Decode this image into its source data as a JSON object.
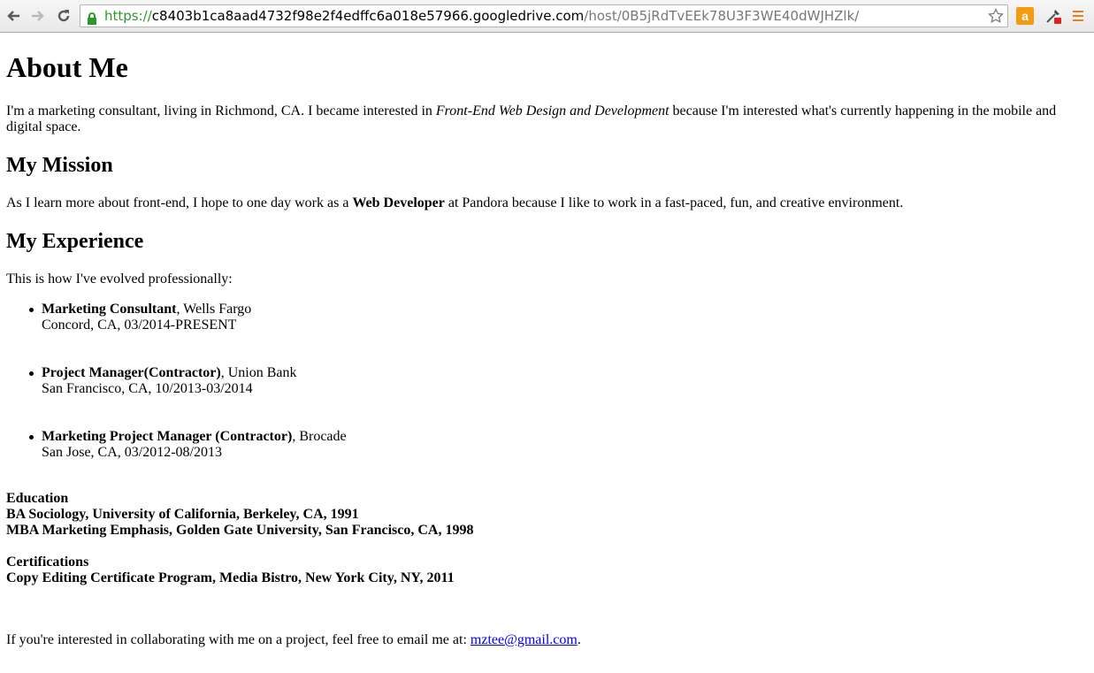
{
  "browser": {
    "url_scheme": "https://",
    "url_host": "c8403b1ca8aad4732f98e2f4edffc6a018e57966.googledrive.com",
    "url_path": "/host/0B5jRdTvEEk78U3F3WE40dWJHZlk/"
  },
  "page": {
    "title": "About Me",
    "intro": {
      "before": "I'm a marketing consultant, living in Richmond, CA. I became interested in ",
      "emphasis": "Front-End Web Design and Development",
      "after": " because I'm interested what's currently happening in the mobile and digital space."
    },
    "mission": {
      "heading": "My Mission",
      "before": "As I learn more about front-end, I hope to one day work as a ",
      "strong": "Web Developer",
      "after": " at Pandora because I like to work in a fast-paced, fun, and creative environment."
    },
    "experience": {
      "heading": "My Experience",
      "intro": "This is how I've evolved professionally:",
      "jobs": [
        {
          "role": "Marketing Consultant",
          "company": ", Wells Fargo",
          "details": "Concord, CA, 03/2014-PRESENT"
        },
        {
          "role": "Project Manager(Contractor)",
          "company": ", Union Bank",
          "details": "San Francisco, CA, 10/2013-03/2014"
        },
        {
          "role": "Marketing Project Manager (Contractor)",
          "company": ", Brocade",
          "details": "San Jose, CA, 03/2012-08/2013"
        }
      ]
    },
    "education": {
      "heading": "Education",
      "items": [
        "BA Sociology, University of California, Berkeley, CA, 1991",
        "MBA Marketing Emphasis, Golden Gate University, San Francisco, CA, 1998"
      ]
    },
    "certifications": {
      "heading": "Certifications",
      "items": [
        "Copy Editing Certificate Program, Media Bistro, New York City, NY, 2011"
      ]
    },
    "contact": {
      "before": "If you're interested in collaborating with me on a project, feel free to email me at: ",
      "email": "mztee@gmail.com",
      "after": "."
    }
  },
  "icons": {
    "back": "back-arrow-icon",
    "forward": "forward-arrow-icon",
    "reload": "reload-icon",
    "lock": "lock-icon",
    "star": "star-icon",
    "amazon": "amazon-extension-icon",
    "dropper": "color-picker-extension-icon",
    "menu": "menu-icon"
  },
  "colors": {
    "secure_green": "#2a9a2a",
    "link_blue": "#0000ee",
    "amazon_orange": "#f39c12"
  }
}
